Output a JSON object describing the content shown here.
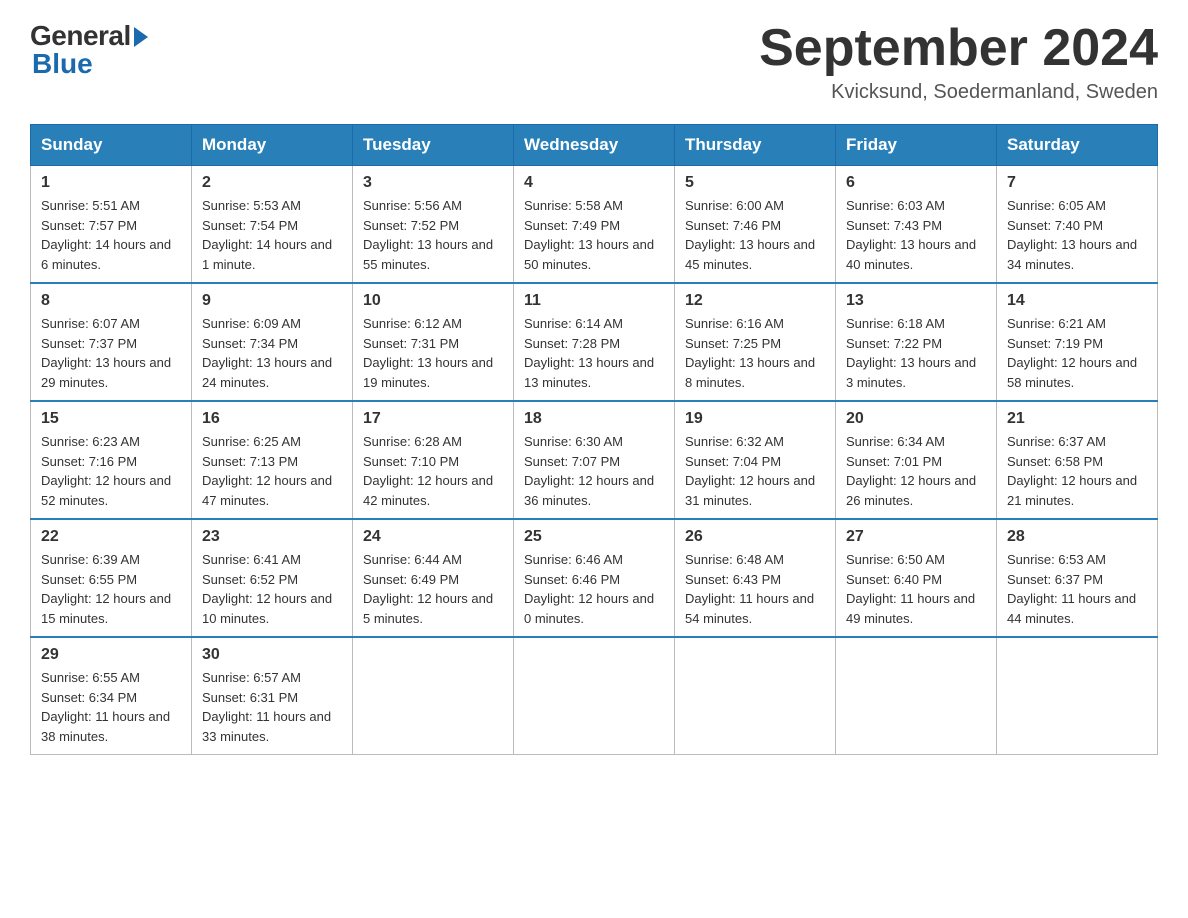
{
  "logo": {
    "general": "General",
    "blue": "Blue"
  },
  "title": "September 2024",
  "location": "Kvicksund, Soedermanland, Sweden",
  "weekdays": [
    "Sunday",
    "Monday",
    "Tuesday",
    "Wednesday",
    "Thursday",
    "Friday",
    "Saturday"
  ],
  "weeks": [
    [
      {
        "day": "1",
        "sunrise": "5:51 AM",
        "sunset": "7:57 PM",
        "daylight": "14 hours and 6 minutes."
      },
      {
        "day": "2",
        "sunrise": "5:53 AM",
        "sunset": "7:54 PM",
        "daylight": "14 hours and 1 minute."
      },
      {
        "day": "3",
        "sunrise": "5:56 AM",
        "sunset": "7:52 PM",
        "daylight": "13 hours and 55 minutes."
      },
      {
        "day": "4",
        "sunrise": "5:58 AM",
        "sunset": "7:49 PM",
        "daylight": "13 hours and 50 minutes."
      },
      {
        "day": "5",
        "sunrise": "6:00 AM",
        "sunset": "7:46 PM",
        "daylight": "13 hours and 45 minutes."
      },
      {
        "day": "6",
        "sunrise": "6:03 AM",
        "sunset": "7:43 PM",
        "daylight": "13 hours and 40 minutes."
      },
      {
        "day": "7",
        "sunrise": "6:05 AM",
        "sunset": "7:40 PM",
        "daylight": "13 hours and 34 minutes."
      }
    ],
    [
      {
        "day": "8",
        "sunrise": "6:07 AM",
        "sunset": "7:37 PM",
        "daylight": "13 hours and 29 minutes."
      },
      {
        "day": "9",
        "sunrise": "6:09 AM",
        "sunset": "7:34 PM",
        "daylight": "13 hours and 24 minutes."
      },
      {
        "day": "10",
        "sunrise": "6:12 AM",
        "sunset": "7:31 PM",
        "daylight": "13 hours and 19 minutes."
      },
      {
        "day": "11",
        "sunrise": "6:14 AM",
        "sunset": "7:28 PM",
        "daylight": "13 hours and 13 minutes."
      },
      {
        "day": "12",
        "sunrise": "6:16 AM",
        "sunset": "7:25 PM",
        "daylight": "13 hours and 8 minutes."
      },
      {
        "day": "13",
        "sunrise": "6:18 AM",
        "sunset": "7:22 PM",
        "daylight": "13 hours and 3 minutes."
      },
      {
        "day": "14",
        "sunrise": "6:21 AM",
        "sunset": "7:19 PM",
        "daylight": "12 hours and 58 minutes."
      }
    ],
    [
      {
        "day": "15",
        "sunrise": "6:23 AM",
        "sunset": "7:16 PM",
        "daylight": "12 hours and 52 minutes."
      },
      {
        "day": "16",
        "sunrise": "6:25 AM",
        "sunset": "7:13 PM",
        "daylight": "12 hours and 47 minutes."
      },
      {
        "day": "17",
        "sunrise": "6:28 AM",
        "sunset": "7:10 PM",
        "daylight": "12 hours and 42 minutes."
      },
      {
        "day": "18",
        "sunrise": "6:30 AM",
        "sunset": "7:07 PM",
        "daylight": "12 hours and 36 minutes."
      },
      {
        "day": "19",
        "sunrise": "6:32 AM",
        "sunset": "7:04 PM",
        "daylight": "12 hours and 31 minutes."
      },
      {
        "day": "20",
        "sunrise": "6:34 AM",
        "sunset": "7:01 PM",
        "daylight": "12 hours and 26 minutes."
      },
      {
        "day": "21",
        "sunrise": "6:37 AM",
        "sunset": "6:58 PM",
        "daylight": "12 hours and 21 minutes."
      }
    ],
    [
      {
        "day": "22",
        "sunrise": "6:39 AM",
        "sunset": "6:55 PM",
        "daylight": "12 hours and 15 minutes."
      },
      {
        "day": "23",
        "sunrise": "6:41 AM",
        "sunset": "6:52 PM",
        "daylight": "12 hours and 10 minutes."
      },
      {
        "day": "24",
        "sunrise": "6:44 AM",
        "sunset": "6:49 PM",
        "daylight": "12 hours and 5 minutes."
      },
      {
        "day": "25",
        "sunrise": "6:46 AM",
        "sunset": "6:46 PM",
        "daylight": "12 hours and 0 minutes."
      },
      {
        "day": "26",
        "sunrise": "6:48 AM",
        "sunset": "6:43 PM",
        "daylight": "11 hours and 54 minutes."
      },
      {
        "day": "27",
        "sunrise": "6:50 AM",
        "sunset": "6:40 PM",
        "daylight": "11 hours and 49 minutes."
      },
      {
        "day": "28",
        "sunrise": "6:53 AM",
        "sunset": "6:37 PM",
        "daylight": "11 hours and 44 minutes."
      }
    ],
    [
      {
        "day": "29",
        "sunrise": "6:55 AM",
        "sunset": "6:34 PM",
        "daylight": "11 hours and 38 minutes."
      },
      {
        "day": "30",
        "sunrise": "6:57 AM",
        "sunset": "6:31 PM",
        "daylight": "11 hours and 33 minutes."
      },
      null,
      null,
      null,
      null,
      null
    ]
  ]
}
